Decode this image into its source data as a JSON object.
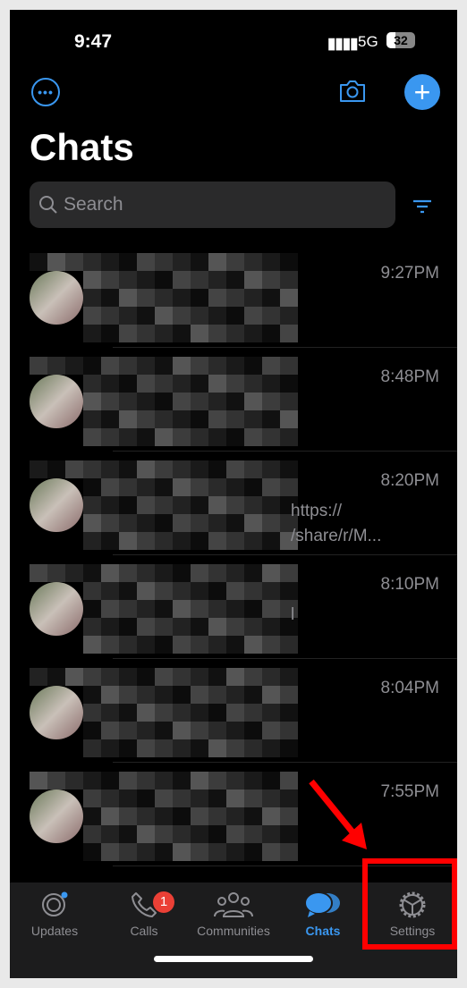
{
  "status": {
    "time": "9:47",
    "network": "5G",
    "battery": "32"
  },
  "header": {
    "title": "Chats",
    "more_icon": "ellipsis-circle-icon",
    "camera_icon": "camera-icon",
    "new_icon": "plus-icon"
  },
  "search": {
    "placeholder": "Search"
  },
  "chats": [
    {
      "time": "9:27PM",
      "snippet": [
        "",
        ""
      ]
    },
    {
      "time": "8:48PM",
      "snippet": [
        "",
        ""
      ]
    },
    {
      "time": "8:20PM",
      "snippet": [
        "https://",
        "/share/r/M..."
      ]
    },
    {
      "time": "8:10PM",
      "snippet": [
        "l",
        ""
      ]
    },
    {
      "time": "8:04PM",
      "snippet": [
        "",
        ""
      ]
    },
    {
      "time": "7:55PM",
      "snippet": [
        "",
        ""
      ]
    }
  ],
  "tabs": [
    {
      "label": "Updates",
      "icon": "updates-icon"
    },
    {
      "label": "Calls",
      "icon": "phone-icon",
      "badge": "1"
    },
    {
      "label": "Communities",
      "icon": "communities-icon"
    },
    {
      "label": "Chats",
      "icon": "chats-icon",
      "active": true
    },
    {
      "label": "Settings",
      "icon": "gear-icon"
    }
  ],
  "colors": {
    "accent": "#3a97f0",
    "badge": "#eb4036",
    "highlight": "#ff0000"
  }
}
